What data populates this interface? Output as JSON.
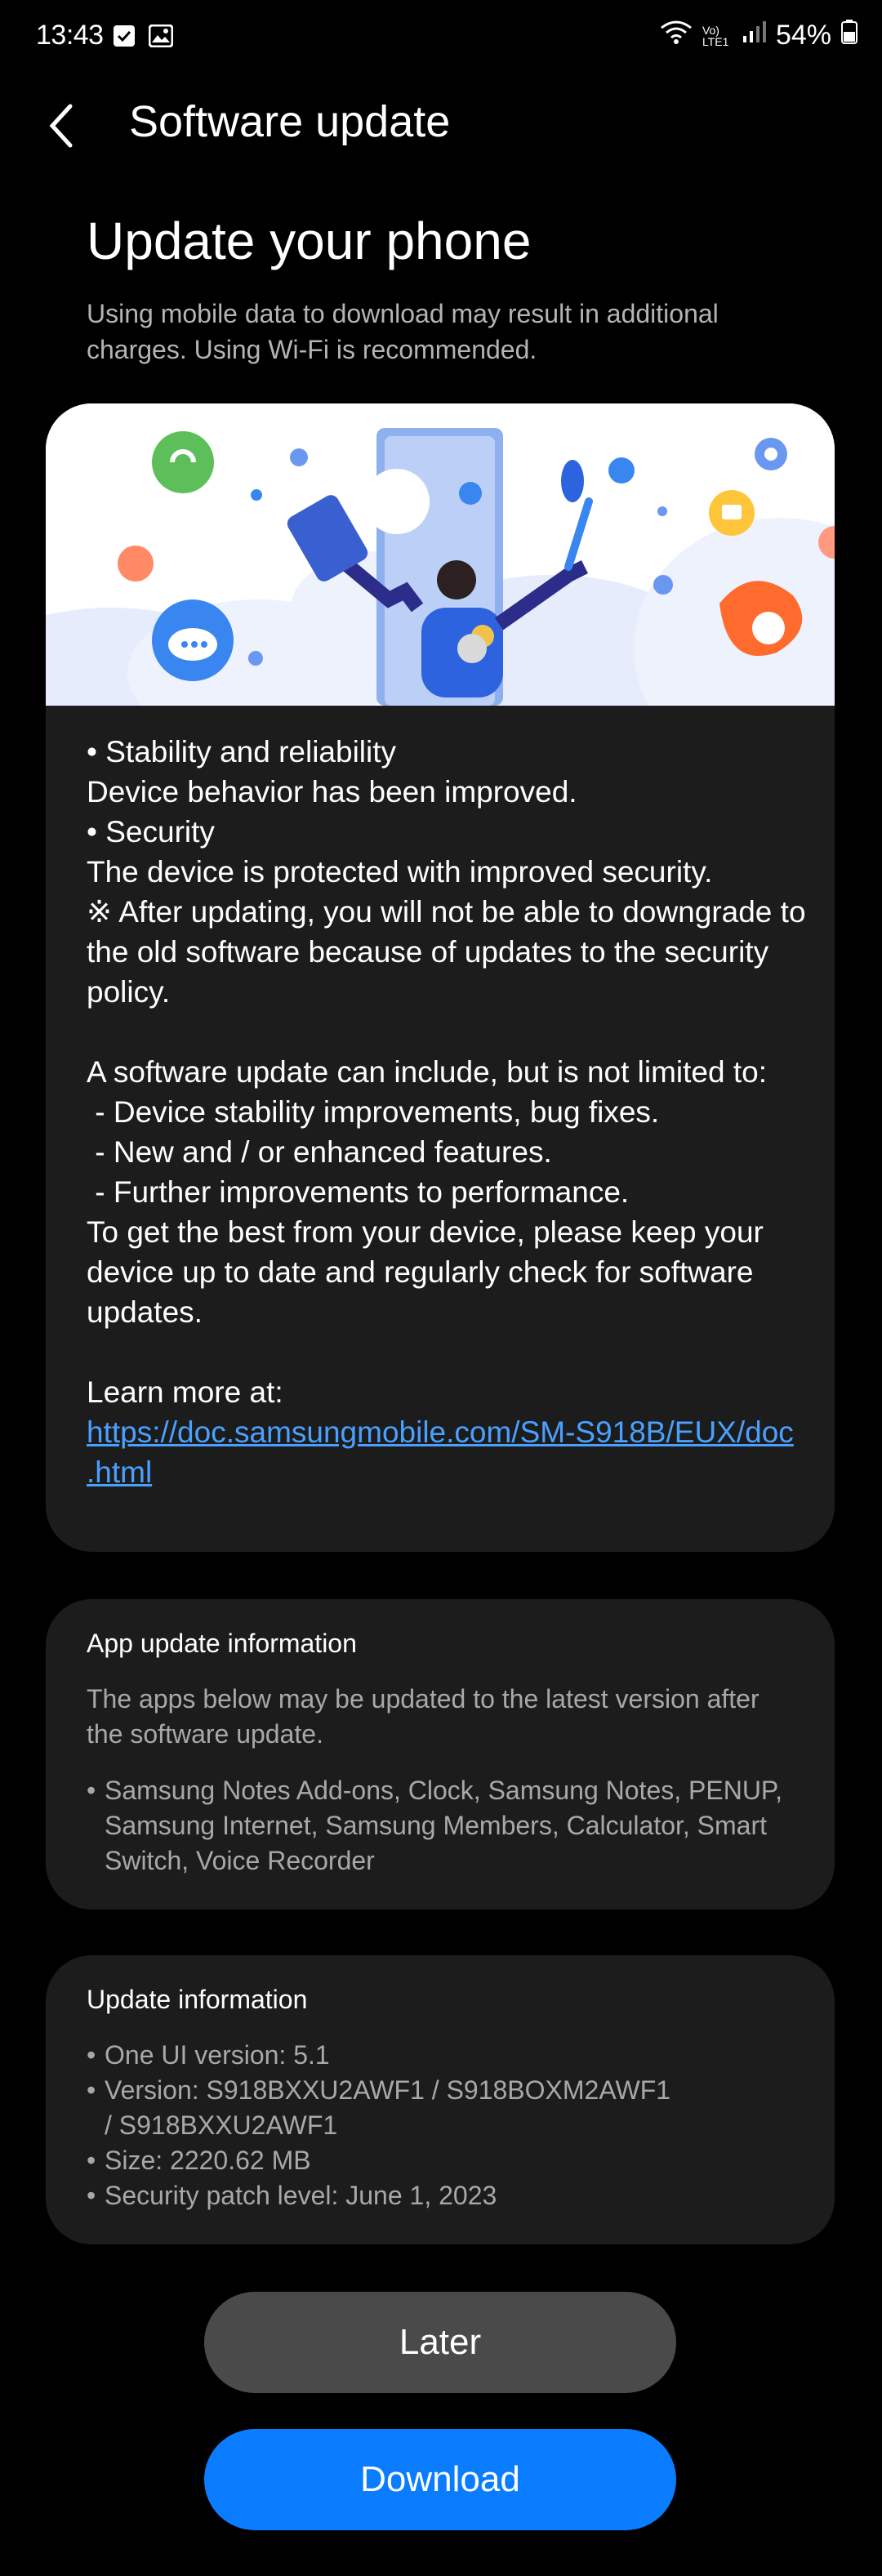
{
  "status_bar": {
    "time": "13:43",
    "network_label": "Vo) LTE1",
    "battery": "54%"
  },
  "header": {
    "title": "Software update"
  },
  "main": {
    "heading": "Update your phone",
    "subtitle": "Using mobile data to download may result in additional charges. Using Wi-Fi is recommended."
  },
  "release_notes": {
    "lines": [
      "• Stability and reliability",
      "Device behavior has been improved.",
      "• Security",
      "The device is protected with improved security.",
      "※ After updating, you will not be able to downgrade to",
      "the old software because of updates to the security",
      "policy.",
      "",
      "A software update can include, but is not limited to:",
      " - Device stability improvements, bug fixes.",
      " - New and / or enhanced features.",
      " - Further improvements to performance.",
      "To get the best from your device, please keep your",
      "device up to date and regularly check for software",
      "updates.",
      "",
      "Learn more at:"
    ],
    "link_line1": "https://doc.samsungmobile.com/SM-S918B/EUX/doc",
    "link_line2": ".html"
  },
  "app_update": {
    "title": "App update information",
    "description": "The apps below may be updated to the latest version after the software update.",
    "apps": "Samsung Notes Add-ons, Clock, Samsung Notes, PENUP, Samsung Internet, Samsung Members, Calculator, Smart Switch, Voice Recorder"
  },
  "update_info": {
    "title": "Update information",
    "items": [
      "One UI version: 5.1",
      "Version: S918BXXU2AWF1 / S918BOXM2AWF1 / S918BXXU2AWF1",
      "Size: 2220.62 MB",
      "Security patch level: June 1, 2023"
    ]
  },
  "buttons": {
    "later": "Later",
    "download": "Download"
  },
  "colors": {
    "background": "#000000",
    "card": "#1c1c1c",
    "link": "#4aa0ff",
    "download_button": "#0a7cff",
    "later_button": "#4a4a4a"
  }
}
